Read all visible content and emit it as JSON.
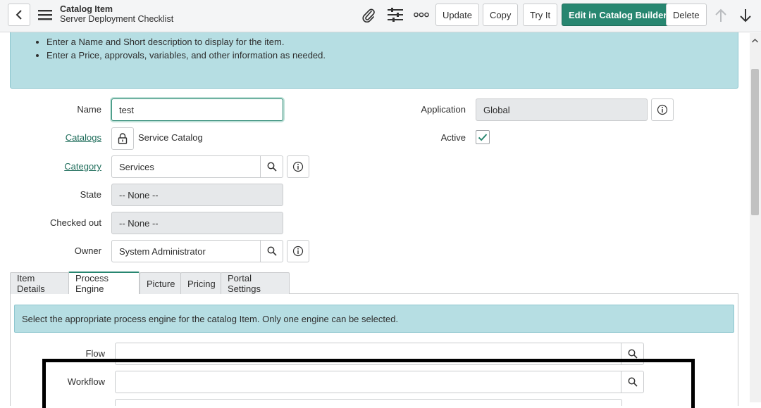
{
  "header": {
    "record_type": "Catalog Item",
    "record_name": "Server Deployment Checklist",
    "buttons": {
      "update": "Update",
      "copy": "Copy",
      "try_it": "Try It",
      "edit_catalog_builder": "Edit in Catalog Builder",
      "delete": "Delete"
    }
  },
  "info": {
    "bullets": [
      "Enter a Name and Short description to display for the item.",
      "Enter a Price, approvals, variables, and other information as needed."
    ]
  },
  "form": {
    "name_label": "Name",
    "name_value": "test",
    "catalogs_label": "Catalogs",
    "catalogs_value": "Service Catalog",
    "category_label": "Category",
    "category_value": "Services",
    "state_label": "State",
    "state_value": "-- None --",
    "checked_out_label": "Checked out",
    "checked_out_value": "-- None --",
    "owner_label": "Owner",
    "owner_value": "System Administrator",
    "application_label": "Application",
    "application_value": "Global",
    "active_label": "Active",
    "active_checked": true
  },
  "tabs": [
    {
      "label": "Item Details",
      "active": false
    },
    {
      "label": "Process Engine",
      "active": true
    },
    {
      "label": "Picture",
      "active": false
    },
    {
      "label": "Pricing",
      "active": false
    },
    {
      "label": "Portal Settings",
      "active": false
    }
  ],
  "process_engine": {
    "message": "Select the appropriate process engine for the catalog Item. Only one engine can be selected.",
    "flow_label": "Flow",
    "flow_value": "",
    "workflow_label": "Workflow",
    "workflow_value": ""
  },
  "colors": {
    "primary": "#278670",
    "info_bg": "#b6dee3",
    "link": "#1f6d5b"
  },
  "icons": [
    "back-arrow-icon",
    "hamburger-menu-icon",
    "paperclip-icon",
    "settings-sliders-icon",
    "more-options-icon",
    "arrow-up-icon",
    "arrow-down-icon",
    "lock-icon",
    "search-icon",
    "info-icon",
    "checkmark-icon"
  ]
}
